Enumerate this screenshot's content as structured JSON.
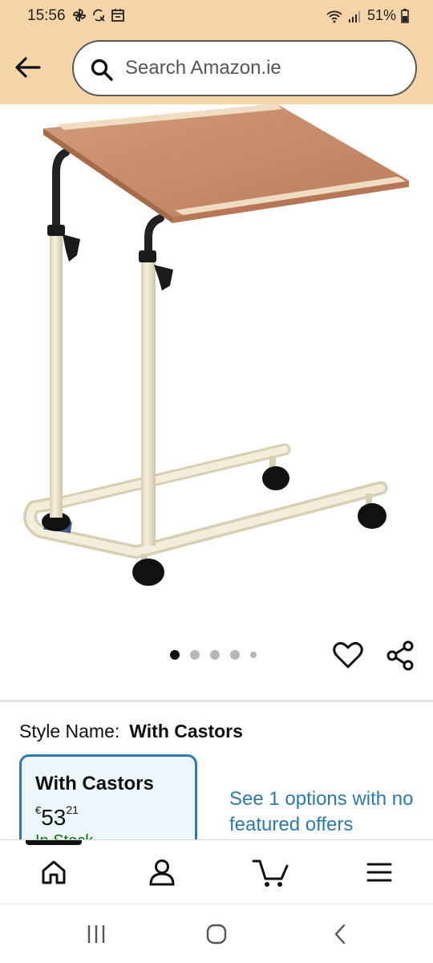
{
  "status_bar": {
    "time": "15:56",
    "battery": "51%",
    "left_icons": [
      "pinwheel-icon",
      "quick-share-icon",
      "calendar-icon"
    ],
    "right_icons": [
      "wifi-icon",
      "signal-icon",
      "battery-icon"
    ]
  },
  "header": {
    "back_icon": "back-arrow-icon",
    "search_placeholder": "Search Amazon.ie",
    "search_icon": "search-icon",
    "background": "#f5d5a8"
  },
  "product": {
    "image_alt": "Overbed table with castors",
    "carousel": {
      "count": 5,
      "active_index": 0
    },
    "wishlist_icon": "heart-icon",
    "share_icon": "share-icon"
  },
  "style_selection": {
    "label": "Style Name:",
    "selected": "With Castors",
    "card": {
      "title": "With Castors",
      "currency": "€",
      "price_whole": "53",
      "price_fraction": "21",
      "stock": "In Stock"
    },
    "other_options_text": "See 1 options with no featured offers",
    "accent": "#2a7ab0"
  },
  "bottom_nav": {
    "items": [
      "home-icon",
      "account-icon",
      "cart-icon",
      "menu-icon"
    ],
    "active_index": 0
  },
  "system_nav": {
    "items": [
      "recents-icon",
      "home-button-icon",
      "back-icon"
    ]
  }
}
